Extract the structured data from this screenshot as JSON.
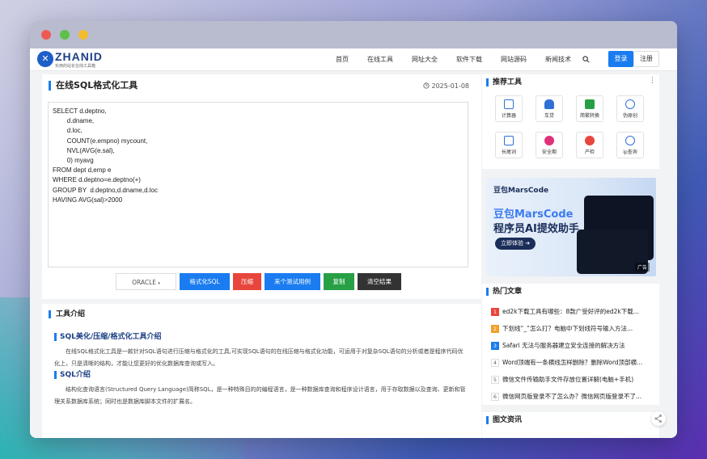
{
  "header": {
    "logo_text": "ZHANID",
    "logo_tagline": "实用的站长在线工具箱",
    "nav": [
      "首页",
      "在线工具",
      "网址大全",
      "软件下载",
      "网站源码",
      "新闻技术"
    ],
    "login": "登录",
    "register": "注册"
  },
  "main": {
    "title": "在线SQL格式化工具",
    "date": "2025-01-08",
    "editor_text": "SELECT d.deptno,\n        d.dname,\n        d.loc,\n        COUNT(e.empno) mycount,\n        NVL(AVG(e.sal),\n        0) myavg\nFROM dept d,emp e\nWHERE d.deptno=e.deptno(+)\nGROUP BY  d.deptno,d.dname,d.loc\nHAVING AVG(sal)>2000",
    "dialect": "ORACLE",
    "buttons": {
      "format": "格式化SQL",
      "compress": "压缩",
      "test": "来个测试用例",
      "copy": "复制",
      "clear": "清空结果"
    },
    "intro_title": "工具介绍",
    "sub1": "SQL美化/压缩/格式化工具介绍",
    "p1": "在线SQL格式化工具是一款针对SQL语句进行压缩与格式化的工具,可实现SQL语句的在线压缩与格式化功能，可运用于对复杂SQL语句的分析或者是程序代码优化上，只是清晰的结构，才能让您更好的优化数据库查询或写入。",
    "sub2": "SQL介绍",
    "p2": "结构化查询语言(Structured Query Language)简称SQL，是一种特殊目的的编程语言，是一种数据库查询和程序设计语言，用于存取数据以及查询、更新和管理关系数据库系统；同时也是数据库脚本文件的扩展名。"
  },
  "sidebar": {
    "recommend_title": "推荐工具",
    "tools": [
      {
        "label": "计算器",
        "color": "#2f6fd6"
      },
      {
        "label": "车贷",
        "color": "#2f6fd6"
      },
      {
        "label": "简繁转换",
        "color": "#27a045"
      },
      {
        "label": "伪原创",
        "color": "#2f6fd6"
      },
      {
        "label": "长尾词",
        "color": "#2f6fd6"
      },
      {
        "label": "安全期",
        "color": "#e0307a"
      },
      {
        "label": "产检",
        "color": "#e8453c"
      },
      {
        "label": "ip查询",
        "color": "#2f6fd6"
      }
    ],
    "ad": {
      "brand": "豆包MarsCode",
      "line1": "豆包MarsCode",
      "line2": "程序员AI提效助手",
      "cta": "立即体验",
      "tag": "广告"
    },
    "hot_title": "热门文章",
    "hot": [
      {
        "num": "1",
        "text": "ed2k下载工具有哪些：8款广受好评的ed2k下载..."
      },
      {
        "num": "2",
        "text": "下划线“_”怎么打？电脑中下划线符号输入方法..."
      },
      {
        "num": "3",
        "text": "Safari 无法与服务器建立安全连接的解决方法"
      },
      {
        "num": "4",
        "text": "Word顶端有一条横线怎样删除？删除Word顶部横..."
      },
      {
        "num": "5",
        "text": "微信文件传输助手文件存放位置详解(电脑+手机)"
      },
      {
        "num": "6",
        "text": "微信网页版登录不了怎么办？微信网页版登录不了..."
      }
    ],
    "news_title": "图文资讯"
  }
}
